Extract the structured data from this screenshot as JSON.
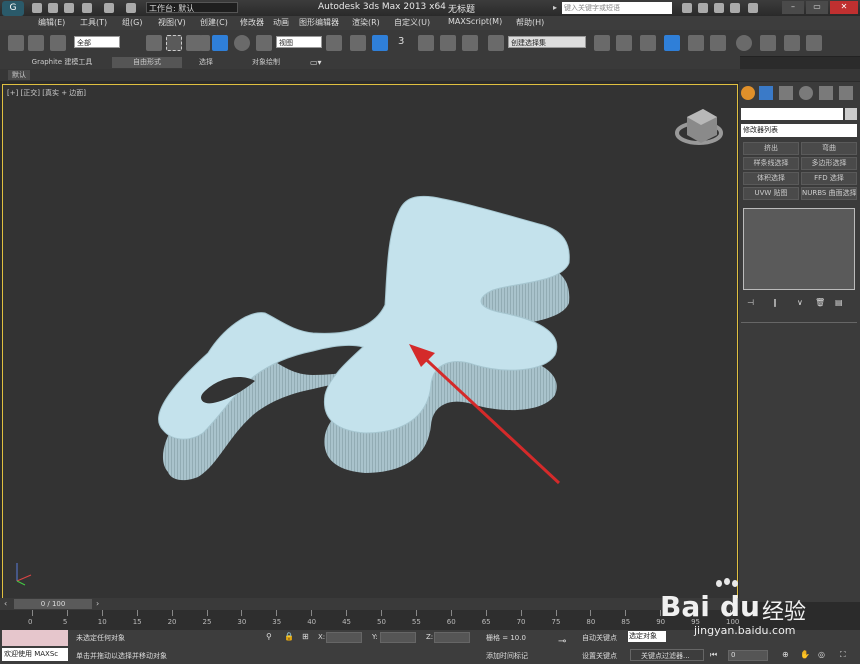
{
  "window": {
    "workspace_label": "工作台: 默认",
    "title": "Autodesk 3ds Max  2013 x64",
    "doc_title": "无标题",
    "search_placeholder": "键入关键字或短语"
  },
  "menu": [
    "编辑(E)",
    "工具(T)",
    "组(G)",
    "视图(V)",
    "创建(C)",
    "修改器",
    "动画",
    "图形编辑器",
    "渲染(R)",
    "自定义(U)",
    "MAXScript(M)",
    "帮助(H)"
  ],
  "toolbar": {
    "selection_filter": "全部",
    "ref_coord": "视图",
    "named_selection": "创建选择集",
    "snap_label": "3"
  },
  "ribbon": {
    "tabs": [
      "Graphite 建模工具",
      "自由形式",
      "选择",
      "对象绘制"
    ],
    "subtab": "默认"
  },
  "viewport": {
    "label": "[+] [正交] [真实 + 边面]"
  },
  "command_panel": {
    "modifier_list": "修改器列表",
    "buttons": [
      "挤出",
      "弯曲",
      "样条线选择",
      "多边形选择",
      "体积选择",
      "FFD 选择",
      "UVW 贴图",
      "NURBS 曲面选择"
    ]
  },
  "timeline": {
    "frame": "0 / 100",
    "ticks": [
      "0",
      "5",
      "10",
      "15",
      "20",
      "25",
      "30",
      "35",
      "40",
      "45",
      "50",
      "55",
      "60",
      "65",
      "70",
      "75",
      "80",
      "85",
      "90",
      "95",
      "100"
    ]
  },
  "status": {
    "welcome": "欢迎使用  MAXSc",
    "line1": "未选定任何对象",
    "line2": "单击并拖动以选择并移动对象",
    "x_label": "X:",
    "y_label": "Y:",
    "z_label": "Z:",
    "grid": "栅格 = 10.0",
    "add_time_tag": "添加时间标记",
    "auto_key": "自动关键点",
    "set_key": "设置关键点",
    "selected_obj": "选定对象",
    "key_filter": "关键点过滤器...",
    "frame_field": "0"
  },
  "watermark": {
    "brand": "Bai",
    "brand2": "du",
    "tag": "经验",
    "url": "jingyan.baidu.com"
  },
  "colors": {
    "shape_fill": "#c4e2ec",
    "shape_side": "#9fb9c2",
    "arrow": "#d42a2a",
    "viewport_border": "#e0c040"
  }
}
